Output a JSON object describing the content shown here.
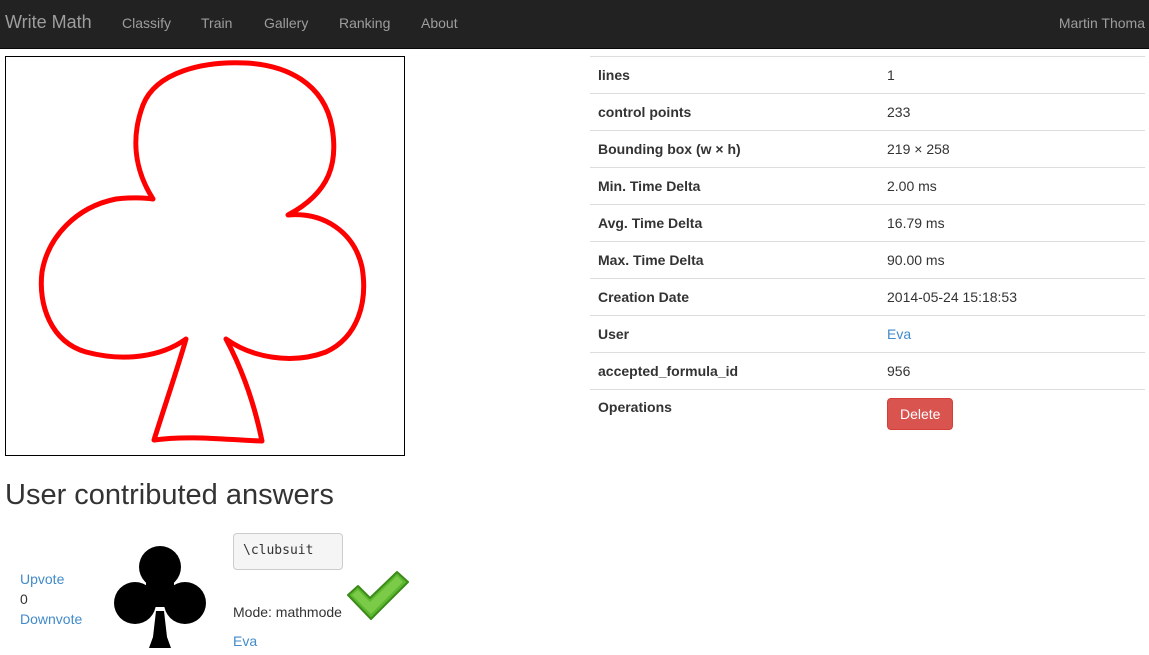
{
  "navbar": {
    "brand": "Write Math",
    "items": [
      "Classify",
      "Train",
      "Gallery",
      "Ranking",
      "About"
    ],
    "user": "Martin Thoma"
  },
  "info_table": {
    "rows": [
      {
        "label": "lines",
        "value": "1"
      },
      {
        "label": "control points",
        "value": "233"
      },
      {
        "label": "Bounding box (w × h)",
        "value": "219 × 258"
      },
      {
        "label": "Min. Time Delta",
        "value": "2.00 ms"
      },
      {
        "label": "Avg. Time Delta",
        "value": "16.79 ms"
      },
      {
        "label": "Max. Time Delta",
        "value": "90.00 ms"
      },
      {
        "label": "Creation Date",
        "value": "2014-05-24 15:18:53"
      },
      {
        "label": "User",
        "value": "Eva"
      },
      {
        "label": "accepted_formula_id",
        "value": "956"
      },
      {
        "label": "Operations",
        "value": "Delete"
      }
    ]
  },
  "drawing": {
    "stroke_color": "#ff0000",
    "icon": "club-drawing"
  },
  "answers": {
    "heading": "User contributed answers",
    "items": [
      {
        "upvote": "Upvote",
        "score": "0",
        "downvote": "Downvote",
        "symbol_icon": "club-symbol-icon",
        "latex": "\\clubsuit",
        "mode": "Mode: mathmode",
        "accepted_icon": "checkmark-icon",
        "user": "Eva"
      }
    ]
  },
  "colors": {
    "link": "#428bca",
    "danger": "#d9534f",
    "navbar": "#222222",
    "accept": "#5cb82e"
  }
}
